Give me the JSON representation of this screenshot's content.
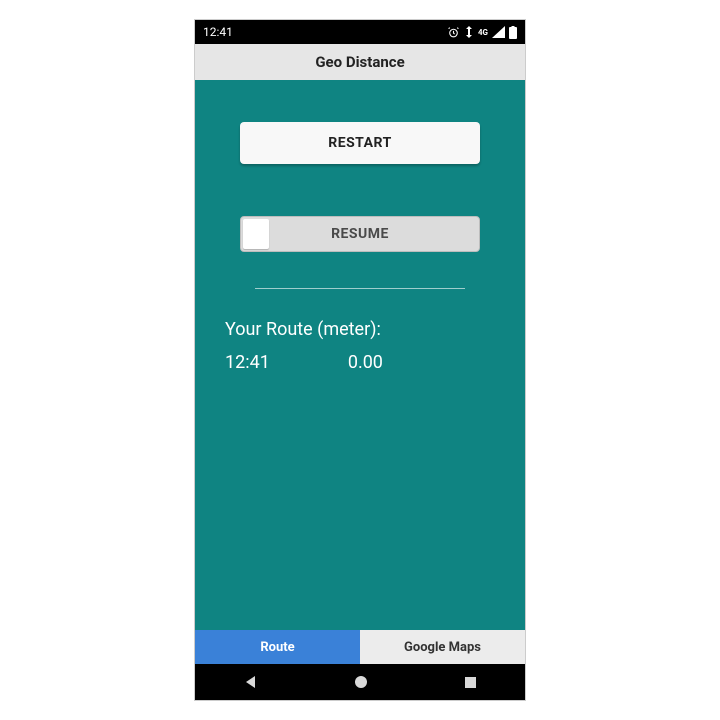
{
  "statusbar": {
    "time": "12:41",
    "network_label": "4G"
  },
  "titlebar": {
    "title": "Geo Distance"
  },
  "buttons": {
    "restart": "RESTART",
    "resume": "RESUME"
  },
  "route": {
    "label": "Your Route (meter):",
    "time": "12:41",
    "distance": "0.00"
  },
  "tabs": {
    "route": "Route",
    "maps": "Google Maps"
  }
}
